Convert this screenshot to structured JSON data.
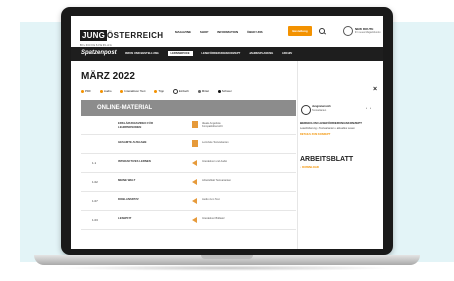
{
  "header": {
    "logo_box": "JUNG",
    "logo_text": "ÖSTERREICH",
    "logo_sub": "BILDUNGSVERLAG",
    "nav": [
      "MAGAZINE",
      "SHOP",
      "INFORMATION",
      "ÜBER UNS"
    ],
    "cta": "Bestellung",
    "user_name": "NEW ROUTE",
    "user_sub": "Ihr neues Magazinkonto"
  },
  "subnav": {
    "brand": "Spatzenpost",
    "tabs": [
      "INFOS UND BESTELLUNG",
      "LERNSERVICE",
      "LESEFÖRDERUNGSKONZEPT",
      "JAHRESPLANUNG",
      "ARCHIV"
    ],
    "active": "LERNSERVICE"
  },
  "main": {
    "title": "MÄRZ 2022",
    "filters": [
      "PDF",
      "Audio",
      "Interaktiver Text",
      "Tipp",
      "Einfach",
      "Mittel",
      "Schwer"
    ],
    "section_head": "ONLINE-MATERIAL"
  },
  "rows": [
    {
      "num": "",
      "title": "ERKLÄRUNGSVIDEO FÜR LEHRPERSONEN",
      "icon": "doc",
      "label": "Ideale Angebote Kompaktübersicht"
    },
    {
      "num": "",
      "title": "GESAMTE AUSGABE",
      "icon": "doc",
      "label": "Lernziele Textvarianten"
    },
    {
      "num": "1.1",
      "title": "INTERAKTIVES LERNEN",
      "icon": "audio",
      "label": "Interaktiver und Audio"
    },
    {
      "num": "1.02",
      "title": "MEINE WELT",
      "icon": "audio",
      "label": "Arbeitsblatt Textvarianten"
    },
    {
      "num": "1.07",
      "title": "DOBLANSPATZ",
      "icon": "audio",
      "label": "Audio zum Text"
    },
    {
      "num": "1.03",
      "title": "LESEPFIT",
      "icon": "audio",
      "label": "Interaktiver Bildsatz"
    }
  ],
  "panel": {
    "publisher": "Jungösterreich",
    "publisher_sub": "Textvarianten",
    "section": "BEREICH IM LESEFÖRDERUNGSKONZEPT",
    "subtitle": "Leseförderung • Textvarianten • aktuelles Lesen",
    "link": "DETAILS ZUM KONZEPT",
    "worksheet": "ARBEITSBLATT",
    "download": "↓ DOWNLOAD"
  },
  "colors": {
    "accent": "#f39200",
    "dark": "#1e1e1e",
    "head_row": "#8c8c8c",
    "background": "#e3f4f7"
  }
}
